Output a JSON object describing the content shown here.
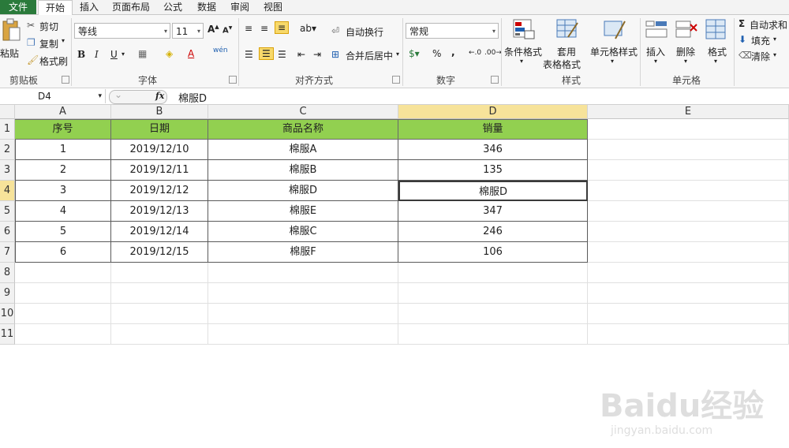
{
  "tabs": [
    "文件",
    "开始",
    "插入",
    "页面布局",
    "公式",
    "数据",
    "审阅",
    "视图"
  ],
  "ribbon": {
    "clipboard": {
      "paste": "粘贴",
      "cut": "剪切",
      "copy": "复制",
      "format_painter": "格式刷",
      "label": "剪贴板"
    },
    "font": {
      "name": "等线",
      "size": "11",
      "bold": "B",
      "italic": "I",
      "underline": "U",
      "font_color": "A",
      "wen": "wén",
      "label": "字体"
    },
    "alignment": {
      "wrap": "自动换行",
      "merge": "合并后居中",
      "label": "对齐方式"
    },
    "number": {
      "format": "常规",
      "percent": "%",
      "comma": ",",
      "label": "数字"
    },
    "styles": {
      "conditional": "条件格式",
      "table_format_1": "套用",
      "table_format_2": "表格格式",
      "cell_styles": "单元格样式",
      "label": "样式"
    },
    "cells": {
      "insert": "插入",
      "delete": "删除",
      "format": "格式",
      "label": "单元格"
    },
    "editing": {
      "autosum": "自动求和",
      "fill": "填充",
      "clear": "清除"
    }
  },
  "formula_bar": {
    "name_box": "D4",
    "fx": "fx",
    "content": "棉服D"
  },
  "columns": [
    "A",
    "B",
    "C",
    "D",
    "E"
  ],
  "rows": [
    "1",
    "2",
    "3",
    "4",
    "5",
    "6",
    "7",
    "8",
    "9",
    "10",
    "11"
  ],
  "table": {
    "headers": [
      "序号",
      "日期",
      "商品名称",
      "销量"
    ],
    "rows": [
      [
        "1",
        "2019/12/10",
        "棉服A",
        "346"
      ],
      [
        "2",
        "2019/12/11",
        "棉服B",
        "135"
      ],
      [
        "3",
        "2019/12/12",
        "棉服D",
        "棉服D"
      ],
      [
        "4",
        "2019/12/13",
        "棉服E",
        "347"
      ],
      [
        "5",
        "2019/12/14",
        "棉服C",
        "246"
      ],
      [
        "6",
        "2019/12/15",
        "棉服F",
        "106"
      ]
    ]
  },
  "colors": {
    "header_fill": "#92d050",
    "file_tab": "#2a7a3b",
    "selected_header": "#f7e39a"
  },
  "watermark": {
    "brand": "Baidu经验",
    "url": "jingyan.baidu.com"
  }
}
